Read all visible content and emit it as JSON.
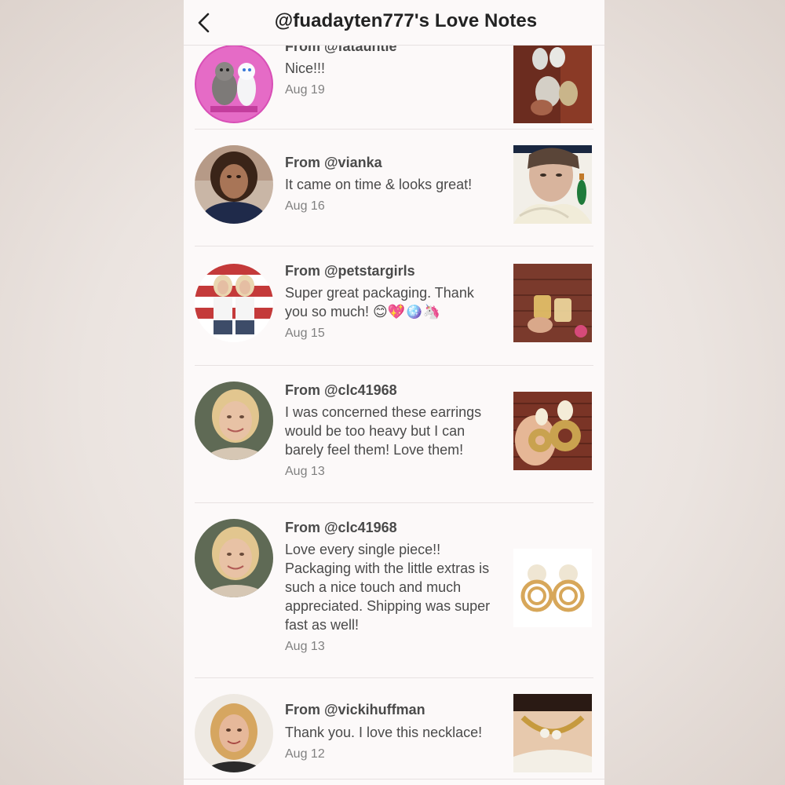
{
  "header": {
    "title": "@fuadayten777's Love Notes",
    "back_icon": "chevron-left-icon"
  },
  "notes": [
    {
      "from": "From @fatauntie",
      "message": "Nice!!!",
      "date": "Aug 19"
    },
    {
      "from": "From @vianka",
      "message": "It came on time & looks great!",
      "date": "Aug 16"
    },
    {
      "from": "From @petstargirls",
      "message": "Super great packaging. Thank you so much! 😊💖🪩🦄",
      "date": "Aug 15"
    },
    {
      "from": "From @clc41968",
      "message": "I was concerned these earrings would be too heavy but I can barely feel them! Love them!",
      "date": "Aug 13"
    },
    {
      "from": "From @clc41968",
      "message": "Love every single piece!! Packaging with the little extras is such a nice touch and much appreciated. Shipping was super fast as well!",
      "date": "Aug 13"
    },
    {
      "from": "From @vickihuffman",
      "message": "Thank you. I love this necklace!",
      "date": "Aug 12"
    }
  ],
  "colors": {
    "background": "#fcf9f9",
    "text": "#4a4a4a",
    "date": "#808080",
    "divider": "#e8e2e2"
  }
}
